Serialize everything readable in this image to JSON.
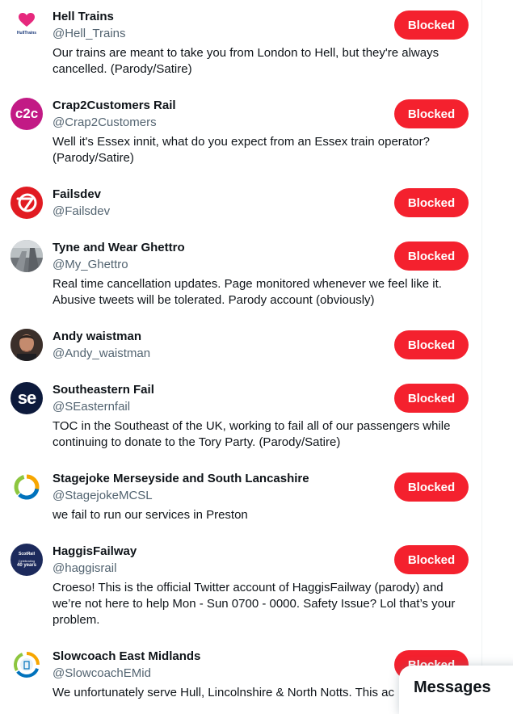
{
  "accounts": [
    {
      "name": "Hell Trains",
      "handle": "@Hell_Trains",
      "bio": "Our trains are meant to take you from London to Hell, but they're always cancelled. (Parody/Satire)",
      "avatar_text": "HullTrains",
      "button": "Blocked"
    },
    {
      "name": "Crap2Customers Rail",
      "handle": "@Crap2Customers",
      "bio": "Well it's Essex innit, what do you expect from an Essex train operator? (Parody/Satire)",
      "avatar_text": "c2c",
      "button": "Blocked"
    },
    {
      "name": "Failsdev",
      "handle": "@Failsdev",
      "bio": "",
      "avatar_text": "",
      "button": "Blocked"
    },
    {
      "name": "Tyne and Wear Ghettro",
      "handle": "@My_Ghettro",
      "bio": "Real time cancellation updates. Page monitored whenever we feel like it. Abusive tweets will be tolerated. Parody account (obviously)",
      "avatar_text": "",
      "button": "Blocked"
    },
    {
      "name": "Andy waistman",
      "handle": "@Andy_waistman",
      "bio": "",
      "avatar_text": "",
      "button": "Blocked"
    },
    {
      "name": "Southeastern Fail",
      "handle": "@SEasternfail",
      "bio": "TOC in the Southeast of the UK, working to fail all of our passengers while continuing to donate to the Tory Party. (Parody/Satire)",
      "avatar_text": "se",
      "button": "Blocked"
    },
    {
      "name": "Stagejoke Merseyside and South Lancashire",
      "handle": "@StagejokeMCSL",
      "bio": "we fail to run our services in Preston",
      "avatar_text": "",
      "button": "Blocked"
    },
    {
      "name": "HaggisFailway",
      "handle": "@haggisrail",
      "bio": "Croeso! This is the official Twitter account of HaggisFailway (parody) and we’re not here to help Mon - Sun 0700 - 0000. Safety Issue? Lol that’s your problem.",
      "avatar_text": "ScotRail",
      "avatar_text2": "Celebrating",
      "avatar_text3": "40 years",
      "button": "Blocked"
    },
    {
      "name": "Slowcoach East Midlands",
      "handle": "@SlowcoachEMid",
      "bio": "We unfortunately serve Hull, Lincolnshire & North Notts. This ac",
      "avatar_text": "",
      "button": "Blocked"
    }
  ],
  "messages_drawer": {
    "title": "Messages"
  },
  "colors": {
    "blocked_button": "#f4212e",
    "handle_text": "#536471",
    "primary_text": "#0f1419"
  }
}
